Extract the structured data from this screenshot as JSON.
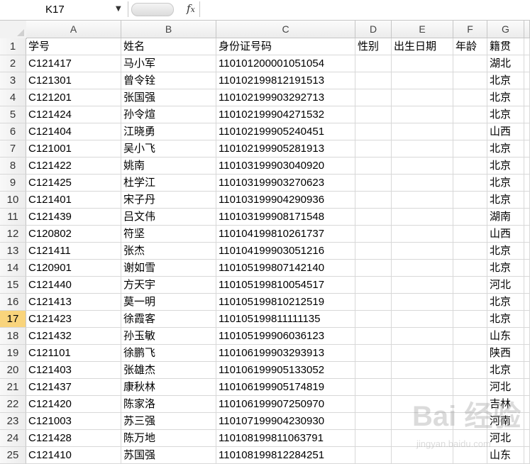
{
  "name_box": "K17",
  "formula_value": "",
  "columns": [
    "A",
    "B",
    "C",
    "D",
    "E",
    "F",
    "G"
  ],
  "selected_row": 17,
  "rows": [
    {
      "n": 1,
      "cells": [
        "学号",
        "姓名",
        "身份证号码",
        "性别",
        "出生日期",
        "年龄",
        "籍贯"
      ]
    },
    {
      "n": 2,
      "cells": [
        "C121417",
        "马小军",
        "110101200001051054",
        "",
        "",
        "",
        "湖北"
      ]
    },
    {
      "n": 3,
      "cells": [
        "C121301",
        "曾令铨",
        "110102199812191513",
        "",
        "",
        "",
        "北京"
      ]
    },
    {
      "n": 4,
      "cells": [
        "C121201",
        "张国强",
        "110102199903292713",
        "",
        "",
        "",
        "北京"
      ]
    },
    {
      "n": 5,
      "cells": [
        "C121424",
        "孙令煊",
        "110102199904271532",
        "",
        "",
        "",
        "北京"
      ]
    },
    {
      "n": 6,
      "cells": [
        "C121404",
        "江晓勇",
        "110102199905240451",
        "",
        "",
        "",
        "山西"
      ]
    },
    {
      "n": 7,
      "cells": [
        "C121001",
        "吴小飞",
        "110102199905281913",
        "",
        "",
        "",
        "北京"
      ]
    },
    {
      "n": 8,
      "cells": [
        "C121422",
        "姚南",
        "110103199903040920",
        "",
        "",
        "",
        "北京"
      ]
    },
    {
      "n": 9,
      "cells": [
        "C121425",
        "杜学江",
        "110103199903270623",
        "",
        "",
        "",
        "北京"
      ]
    },
    {
      "n": 10,
      "cells": [
        "C121401",
        "宋子丹",
        "110103199904290936",
        "",
        "",
        "",
        "北京"
      ]
    },
    {
      "n": 11,
      "cells": [
        "C121439",
        "吕文伟",
        "110103199908171548",
        "",
        "",
        "",
        "湖南"
      ]
    },
    {
      "n": 12,
      "cells": [
        "C120802",
        "符坚",
        "110104199810261737",
        "",
        "",
        "",
        "山西"
      ]
    },
    {
      "n": 13,
      "cells": [
        "C121411",
        "张杰",
        "110104199903051216",
        "",
        "",
        "",
        "北京"
      ]
    },
    {
      "n": 14,
      "cells": [
        "C120901",
        "谢如雪",
        "110105199807142140",
        "",
        "",
        "",
        "北京"
      ]
    },
    {
      "n": 15,
      "cells": [
        "C121440",
        "方天宇",
        "110105199810054517",
        "",
        "",
        "",
        "河北"
      ]
    },
    {
      "n": 16,
      "cells": [
        "C121413",
        "莫一明",
        "110105199810212519",
        "",
        "",
        "",
        "北京"
      ]
    },
    {
      "n": 17,
      "cells": [
        "C121423",
        "徐霞客",
        "110105199811111135",
        "",
        "",
        "",
        "北京"
      ]
    },
    {
      "n": 18,
      "cells": [
        "C121432",
        "孙玉敏",
        "110105199906036123",
        "",
        "",
        "",
        "山东"
      ]
    },
    {
      "n": 19,
      "cells": [
        "C121101",
        "徐鹏飞",
        "110106199903293913",
        "",
        "",
        "",
        "陕西"
      ]
    },
    {
      "n": 20,
      "cells": [
        "C121403",
        "张雄杰",
        "110106199905133052",
        "",
        "",
        "",
        "北京"
      ]
    },
    {
      "n": 21,
      "cells": [
        "C121437",
        "康秋林",
        "110106199905174819",
        "",
        "",
        "",
        "河北"
      ]
    },
    {
      "n": 22,
      "cells": [
        "C121420",
        "陈家洛",
        "110106199907250970",
        "",
        "",
        "",
        "吉林"
      ]
    },
    {
      "n": 23,
      "cells": [
        "C121003",
        "苏三强",
        "110107199904230930",
        "",
        "",
        "",
        "河南"
      ]
    },
    {
      "n": 24,
      "cells": [
        "C121428",
        "陈万地",
        "110108199811063791",
        "",
        "",
        "",
        "河北"
      ]
    },
    {
      "n": 25,
      "cells": [
        "C121410",
        "苏国强",
        "110108199812284251",
        "",
        "",
        "",
        "山东"
      ]
    }
  ],
  "watermark_text": "Bai 经验",
  "watermark_url": "jingyan.baidu.com"
}
